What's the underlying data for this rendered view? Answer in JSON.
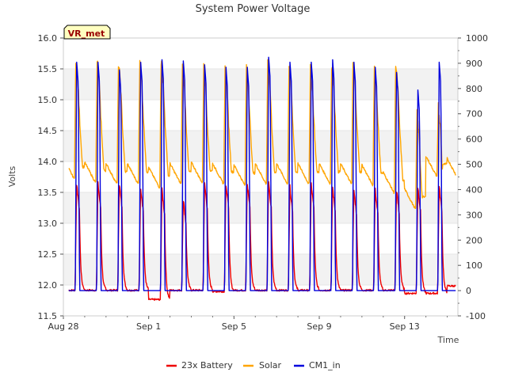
{
  "chart_data": {
    "type": "line",
    "title": "System Power Voltage",
    "xlabel": "Time",
    "ylabel": "Volts",
    "ylim": [
      11.5,
      16.0
    ],
    "y2lim": [
      -100,
      1000
    ],
    "x_range": [
      "Aug 28",
      "Sep 15 12:00"
    ],
    "x_ticks": [
      "Aug 28",
      "Sep 1",
      "Sep 5",
      "Sep 9",
      "Sep 13"
    ],
    "y_ticks": [
      "11.5",
      "12.0",
      "12.5",
      "13.0",
      "13.5",
      "14.0",
      "14.5",
      "15.0",
      "15.5",
      "16.0"
    ],
    "y2_ticks": [
      "-100",
      "0",
      "100",
      "200",
      "300",
      "400",
      "500",
      "600",
      "700",
      "800",
      "900",
      "1000"
    ],
    "annotation": "VR_met",
    "grid": "horizontal bands",
    "legend_position": "bottom",
    "colors": {
      "23x Battery": "#ee0000",
      "Solar": "#ffa500",
      "CM1_in": "#0000dd"
    },
    "series": [
      {
        "name": "23x Battery",
        "axis": "left",
        "x": [
          "Aug 28",
          "Aug 29",
          "Aug 30",
          "Aug 31",
          "Sep 1",
          "Sep 2",
          "Sep 3",
          "Sep 4",
          "Sep 5",
          "Sep 6",
          "Sep 7",
          "Sep 8",
          "Sep 9",
          "Sep 10",
          "Sep 11",
          "Sep 12",
          "Sep 13",
          "Sep 14",
          "Sep 15"
        ],
        "min_values": [
          11.9,
          11.9,
          11.9,
          11.9,
          11.75,
          11.9,
          11.9,
          11.88,
          11.9,
          11.9,
          11.9,
          11.9,
          11.9,
          11.9,
          11.9,
          11.9,
          11.85,
          11.85,
          11.97
        ],
        "max_values": [
          13.65,
          13.65,
          13.65,
          13.6,
          13.55,
          13.4,
          13.65,
          13.65,
          13.65,
          13.65,
          13.6,
          13.65,
          13.6,
          13.55,
          13.55,
          13.55,
          13.6,
          13.6,
          13.6
        ]
      },
      {
        "name": "Solar",
        "axis": "right",
        "x": [
          "Aug 28",
          "Aug 29",
          "Aug 30",
          "Aug 31",
          "Sep 1",
          "Sep 2",
          "Sep 3",
          "Sep 4",
          "Sep 5",
          "Sep 6",
          "Sep 7",
          "Sep 8",
          "Sep 9",
          "Sep 10",
          "Sep 11",
          "Sep 12",
          "Sep 13",
          "Sep 14",
          "Sep 15"
        ],
        "peak_values": [
          920,
          915,
          905,
          910,
          915,
          890,
          885,
          880,
          890,
          905,
          895,
          890,
          900,
          905,
          890,
          900,
          700,
          730,
          430
        ],
        "night_values": [
          440,
          425,
          420,
          420,
          405,
          420,
          425,
          420,
          415,
          420,
          420,
          420,
          420,
          420,
          415,
          385,
          320,
          450,
          440
        ]
      },
      {
        "name": "CM1_in",
        "axis": "right",
        "x": [
          "Aug 28",
          "Aug 29",
          "Aug 30",
          "Aug 31",
          "Sep 1",
          "Sep 2",
          "Sep 3",
          "Sep 4",
          "Sep 5",
          "Sep 6",
          "Sep 7",
          "Sep 8",
          "Sep 9",
          "Sep 10",
          "Sep 11",
          "Sep 12",
          "Sep 13",
          "Sep 14",
          "Sep 15"
        ],
        "peak_values": [
          910,
          910,
          880,
          910,
          920,
          915,
          900,
          890,
          890,
          930,
          910,
          910,
          920,
          910,
          890,
          870,
          800,
          910,
          0
        ],
        "night_values": [
          0,
          0,
          0,
          0,
          0,
          0,
          0,
          0,
          0,
          0,
          0,
          0,
          0,
          0,
          0,
          0,
          0,
          0,
          0
        ]
      }
    ]
  }
}
